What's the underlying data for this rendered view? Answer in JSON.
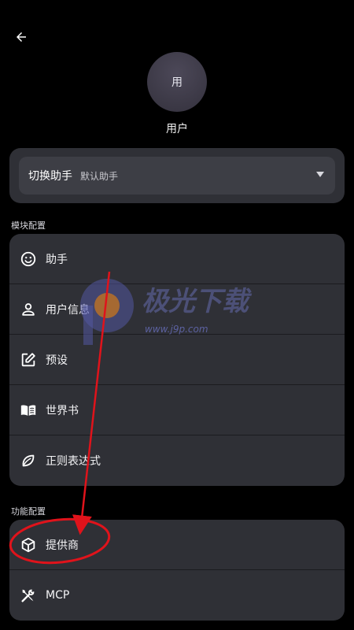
{
  "header": {
    "back_icon": "arrow-left-icon"
  },
  "profile": {
    "avatar_text": "用",
    "name": "用户"
  },
  "assistant": {
    "label": "切换助手",
    "value": "默认助手"
  },
  "module_section": {
    "title": "模块配置",
    "items": [
      {
        "label": "助手",
        "icon": "smiley-icon"
      },
      {
        "label": "用户信息",
        "icon": "person-icon"
      },
      {
        "label": "预设",
        "icon": "edit-icon"
      },
      {
        "label": "世界书",
        "icon": "book-icon"
      },
      {
        "label": "正则表达式",
        "icon": "leaf-icon"
      }
    ]
  },
  "function_section": {
    "title": "功能配置",
    "items": [
      {
        "label": "提供商",
        "icon": "box-icon"
      },
      {
        "label": "MCP",
        "icon": "tools-icon"
      }
    ]
  },
  "watermark": {
    "brand": "极光下载",
    "url": "www.j9p.com"
  },
  "colors": {
    "background": "#000000",
    "card": "#2f3036",
    "annotation": "#e0131b"
  }
}
